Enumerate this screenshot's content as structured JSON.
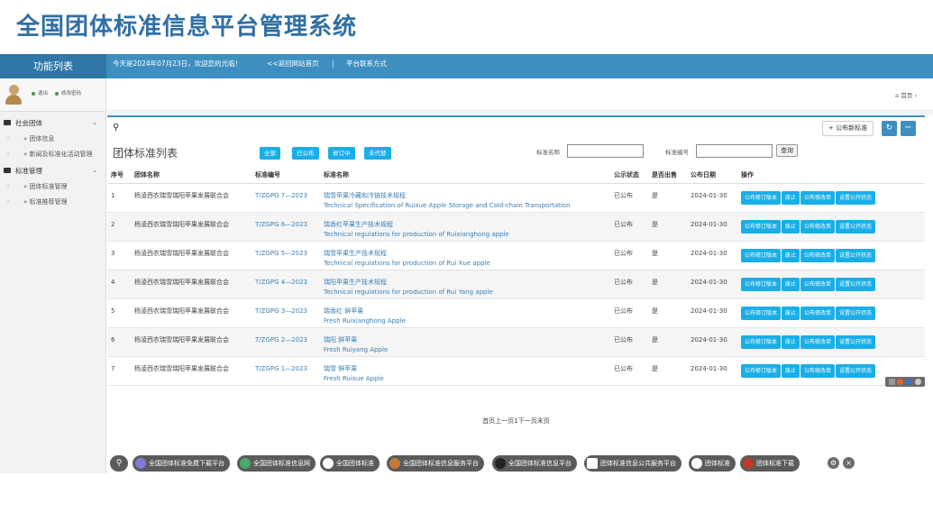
{
  "header": {
    "title": "全国团体标准信息平台管理系统"
  },
  "topbar": {
    "menu_title": "功能列表",
    "welcome": "今天是2024年07月23日，欢迎您的光临！",
    "back_link": "<<返回网站首页",
    "separator": "|",
    "contact_link": "平台联系方式"
  },
  "user": {
    "logout": "退出",
    "change_password": "修改密码"
  },
  "sidebar": {
    "groups": [
      {
        "label": "社会团体",
        "items": [
          "» 团体信息",
          "» 新闻及标准化活动管理"
        ]
      },
      {
        "label": "标准管理",
        "items": [
          "» 团体标准管理",
          "» 标准推荐管理"
        ]
      }
    ]
  },
  "breadcrumb": {
    "home": "首页"
  },
  "panel": {
    "publish_new": "公布新标准",
    "refresh_icon": "↻",
    "minimize_icon": "−",
    "list_title": "团体标准列表",
    "filters": [
      "全部",
      "已公布",
      "修订中",
      "未代替"
    ],
    "name_label": "标准名称",
    "number_label": "标准编号",
    "search": "查询"
  },
  "table": {
    "headers": [
      "序号",
      "团体名称",
      "标准编号",
      "标准名称",
      "公示状态",
      "是否出售",
      "公布日期",
      "操作"
    ],
    "actions": [
      "公布修订版本",
      "废止",
      "公布修改单",
      "设置公开状态"
    ],
    "rows": [
      {
        "no": "1",
        "org": "杨凌西农瑞雪瑞阳苹果发展联合会",
        "code": "T/ZGPG 7—2023",
        "name_cn": "瑞雪苹果冷藏和冷链技术规程",
        "name_en": "Technical Specification of Ruixue Apple Storage and Cold-chain Transportation",
        "status": "已公布",
        "sale": "是",
        "date": "2024-01-30"
      },
      {
        "no": "2",
        "org": "杨凌西农瑞雪瑞阳苹果发展联合会",
        "code": "T/ZGPG 6—2023",
        "name_cn": "瑞香红苹果生产技术规程",
        "name_en": "Technical regulations for production of Ruixianghong apple",
        "status": "已公布",
        "sale": "是",
        "date": "2024-01-30"
      },
      {
        "no": "3",
        "org": "杨凌西农瑞雪瑞阳苹果发展联合会",
        "code": "T/ZGPG 5—2023",
        "name_cn": "瑞雪苹果生产技术规程",
        "name_en": "Technical regulations for production of Rui Xue apple",
        "status": "已公布",
        "sale": "是",
        "date": "2024-01-30"
      },
      {
        "no": "4",
        "org": "杨凌西农瑞雪瑞阳苹果发展联合会",
        "code": "T/ZGPG 4—2023",
        "name_cn": "瑞阳苹果生产技术规程",
        "name_en": "Technical regulations for production of Rui Yang apple",
        "status": "已公布",
        "sale": "是",
        "date": "2024-01-30"
      },
      {
        "no": "5",
        "org": "杨凌西农瑞雪瑞阳苹果发展联合会",
        "code": "T/ZGPG 3—2023",
        "name_cn": "瑞香红 鲜苹果",
        "name_en": "Fresh Ruixianghong Apple",
        "status": "已公布",
        "sale": "是",
        "date": "2024-01-30"
      },
      {
        "no": "6",
        "org": "杨凌西农瑞雪瑞阳苹果发展联合会",
        "code": "T/ZGPG 2—2023",
        "name_cn": "瑞阳 鲜苹果",
        "name_en": "Fresh Ruiyang Apple",
        "status": "已公布",
        "sale": "是",
        "date": "2024-01-30"
      },
      {
        "no": "7",
        "org": "杨凌西农瑞雪瑞阳苹果发展联合会",
        "code": "T/ZGPG 1—2023",
        "name_cn": "瑞雪 鲜苹果",
        "name_en": "Fresh Ruixue Apple",
        "status": "已公布",
        "sale": "是",
        "date": "2024-01-30"
      }
    ]
  },
  "pager": {
    "text": "首页上一页1下一页末页"
  },
  "footer": {
    "links": [
      "全国团体标准免费下载平台",
      "全国团体标准信息网",
      "全国团体标准",
      "全国团体标准信息服务平台",
      "全国团体标准信息平台",
      "团体标准信息公共服务平台",
      "团体标准",
      "团体标准下载"
    ],
    "search_icon": "⚲",
    "settings_icon": "⚙",
    "close_icon": "×"
  },
  "colors": {
    "accent": "#3e8fc0",
    "button": "#19aee8",
    "title": "#2f6fa5"
  }
}
